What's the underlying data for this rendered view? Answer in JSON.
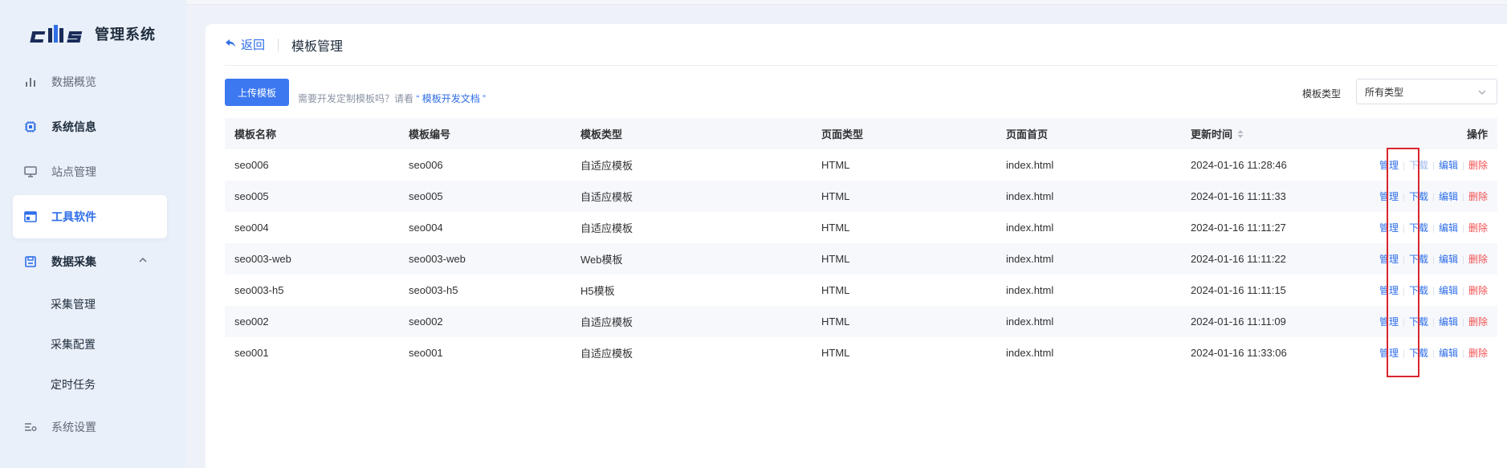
{
  "app": {
    "logo_text": "管理系统",
    "accent": "#2f6ee8",
    "danger": "#f25050"
  },
  "sidebar": {
    "items": [
      {
        "label": "数据概览",
        "icon": "bar-chart-icon"
      },
      {
        "label": "系统信息",
        "icon": "chip-icon"
      },
      {
        "label": "站点管理",
        "icon": "monitor-icon"
      },
      {
        "label": "工具软件",
        "icon": "window-icon",
        "active": true
      },
      {
        "label": "数据采集",
        "icon": "save-icon",
        "expanded": true
      },
      {
        "label": "系统设置",
        "icon": "settings-list-icon"
      }
    ],
    "subitems": [
      {
        "label": "采集管理"
      },
      {
        "label": "采集配置"
      },
      {
        "label": "定时任务"
      }
    ]
  },
  "header": {
    "back_label": "返回",
    "title": "模板管理"
  },
  "toolbar": {
    "upload_label": "上传模板",
    "hint_prefix": "需要开发定制模板吗？请看",
    "hint_link": "“ 模板开发文档 ”",
    "filter_label": "模板类型",
    "filter_value": "所有类型"
  },
  "table": {
    "columns": [
      "模板名称",
      "模板编号",
      "模板类型",
      "页面类型",
      "页面首页",
      "更新时间",
      "操作"
    ],
    "actions": {
      "manage": "管理",
      "download": "下载",
      "edit": "编辑",
      "delete": "删除"
    },
    "rows": [
      {
        "name": "seo006",
        "code": "seo006",
        "type": "自适应模板",
        "page_type": "HTML",
        "home": "index.html",
        "updated": "2024-01-16 11:28:46"
      },
      {
        "name": "seo005",
        "code": "seo005",
        "type": "自适应模板",
        "page_type": "HTML",
        "home": "index.html",
        "updated": "2024-01-16 11:11:33"
      },
      {
        "name": "seo004",
        "code": "seo004",
        "type": "自适应模板",
        "page_type": "HTML",
        "home": "index.html",
        "updated": "2024-01-16 11:11:27"
      },
      {
        "name": "seo003-web",
        "code": "seo003-web",
        "type": "Web模板",
        "page_type": "HTML",
        "home": "index.html",
        "updated": "2024-01-16 11:11:22"
      },
      {
        "name": "seo003-h5",
        "code": "seo003-h5",
        "type": "H5模板",
        "page_type": "HTML",
        "home": "index.html",
        "updated": "2024-01-16 11:11:15"
      },
      {
        "name": "seo002",
        "code": "seo002",
        "type": "自适应模板",
        "page_type": "HTML",
        "home": "index.html",
        "updated": "2024-01-16 11:11:09"
      },
      {
        "name": "seo001",
        "code": "seo001",
        "type": "自适应模板",
        "page_type": "HTML",
        "home": "index.html",
        "updated": "2024-01-16 11:33:06"
      }
    ]
  }
}
